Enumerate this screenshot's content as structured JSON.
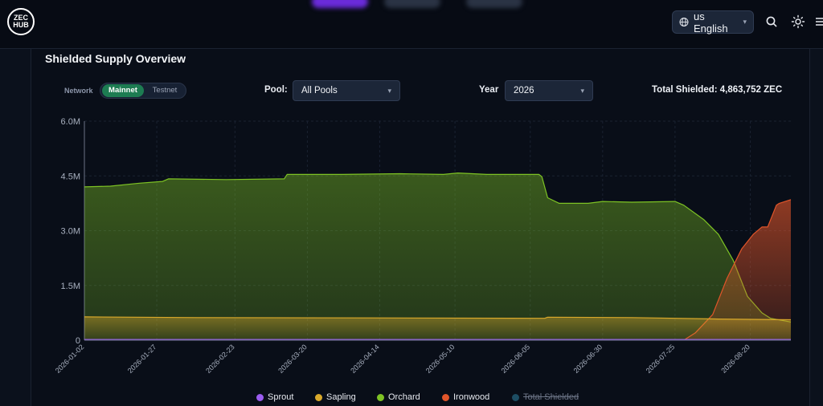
{
  "header": {
    "logo_text": "ZEC HUB",
    "language_label": "us English",
    "language_icon": "globe-icon",
    "search_icon": "search-icon",
    "theme_icon": "sun-icon",
    "menu_icon": "menu-icon"
  },
  "card": {
    "title": "Shielded Supply Overview",
    "network_label": "Network",
    "network_options": [
      "Mainnet",
      "Testnet"
    ],
    "network_selected": "Mainnet",
    "pool_label": "Pool:",
    "pool_value": "All Pools",
    "year_label": "Year",
    "year_value": "2026",
    "total_label": "Total Shielded: 4,863,752 ZEC"
  },
  "colors": {
    "sprout": "#9b5cf0",
    "sapling": "#d9a92b",
    "orchard": "#7ec324",
    "ironwood": "#e0552a",
    "total": "#1d4d63",
    "accent": "#1d7c52"
  },
  "chart_data": {
    "type": "area",
    "y_ticks": [
      "0",
      "1.5M",
      "3.0M",
      "4.5M",
      "6.0M"
    ],
    "ylim": [
      0,
      6000000
    ],
    "x_tick_labels": [
      "2026-01-02",
      "2026-01-27",
      "2026-02-23",
      "2026-03-20",
      "2026-04-14",
      "2026-05-10",
      "2026-06-05",
      "2026-06-30",
      "2026-07-25",
      "2026-08-20"
    ],
    "x_tick_days": [
      1,
      26,
      53,
      78,
      103,
      129,
      155,
      180,
      205,
      231
    ],
    "xlim": [
      1,
      245
    ],
    "legend": [
      {
        "name": "Sprout",
        "color_key": "sprout",
        "hidden": false
      },
      {
        "name": "Sapling",
        "color_key": "sapling",
        "hidden": false
      },
      {
        "name": "Orchard",
        "color_key": "orchard",
        "hidden": false
      },
      {
        "name": "Ironwood",
        "color_key": "ironwood",
        "hidden": false
      },
      {
        "name": "Total Shielded",
        "color_key": "total",
        "hidden": true
      }
    ],
    "series": [
      {
        "name": "Sprout",
        "color_key": "sprout",
        "points": [
          [
            1,
            20000
          ],
          [
            245,
            20000
          ]
        ]
      },
      {
        "name": "Sapling",
        "color_key": "sapling",
        "points": [
          [
            1,
            640000
          ],
          [
            40,
            620000
          ],
          [
            100,
            610000
          ],
          [
            160,
            600000
          ],
          [
            161,
            630000
          ],
          [
            190,
            620000
          ],
          [
            220,
            580000
          ],
          [
            245,
            560000
          ]
        ]
      },
      {
        "name": "Orchard",
        "color_key": "orchard",
        "points": [
          [
            1,
            4200000
          ],
          [
            10,
            4220000
          ],
          [
            20,
            4300000
          ],
          [
            28,
            4350000
          ],
          [
            30,
            4420000
          ],
          [
            50,
            4400000
          ],
          [
            70,
            4420000
          ],
          [
            71,
            4540000
          ],
          [
            90,
            4540000
          ],
          [
            110,
            4560000
          ],
          [
            125,
            4540000
          ],
          [
            130,
            4580000
          ],
          [
            140,
            4540000
          ],
          [
            158,
            4540000
          ],
          [
            159,
            4480000
          ],
          [
            161,
            3900000
          ],
          [
            165,
            3750000
          ],
          [
            175,
            3750000
          ],
          [
            180,
            3800000
          ],
          [
            190,
            3780000
          ],
          [
            205,
            3800000
          ],
          [
            208,
            3700000
          ],
          [
            215,
            3300000
          ],
          [
            220,
            2900000
          ],
          [
            225,
            2200000
          ],
          [
            230,
            1200000
          ],
          [
            235,
            750000
          ],
          [
            238,
            600000
          ],
          [
            245,
            500000
          ]
        ]
      },
      {
        "name": "Ironwood",
        "color_key": "ironwood",
        "points": [
          [
            208,
            0
          ],
          [
            212,
            200000
          ],
          [
            218,
            700000
          ],
          [
            223,
            1700000
          ],
          [
            228,
            2500000
          ],
          [
            232,
            2900000
          ],
          [
            235,
            3100000
          ],
          [
            237,
            3100000
          ],
          [
            239,
            3500000
          ],
          [
            240,
            3700000
          ],
          [
            241,
            3750000
          ],
          [
            245,
            3850000
          ]
        ]
      }
    ]
  }
}
